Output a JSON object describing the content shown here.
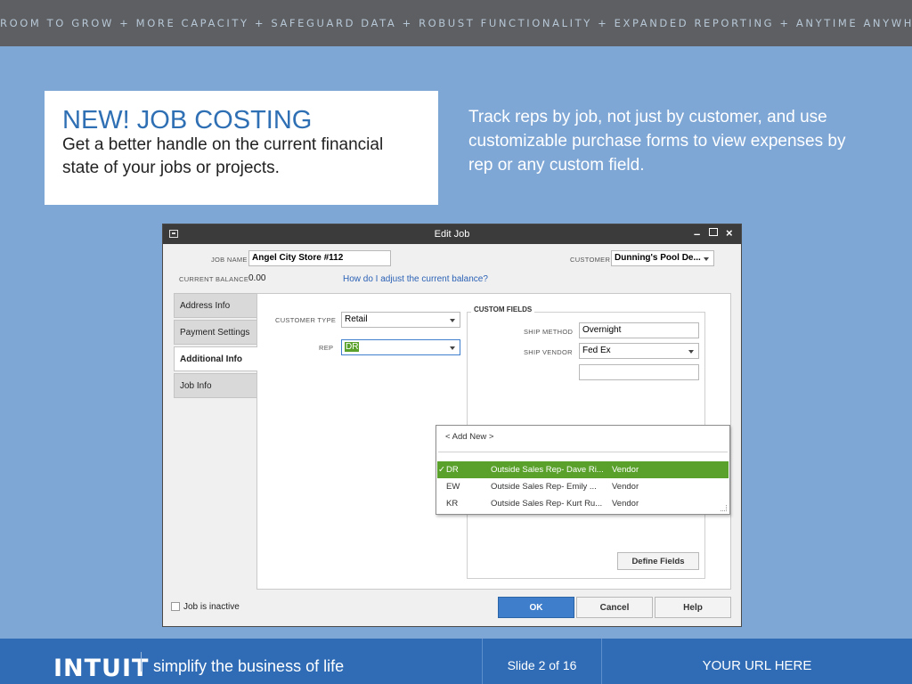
{
  "topbar": {
    "text": "ROOM TO GROW + MORE CAPACITY + SAFEGUARD DATA + ROBUST FUNCTIONALITY + EXPANDED REPORTING + ANYTIME ANYWHERE"
  },
  "headline": {
    "new": "NEW!",
    "title": "JOB COSTING",
    "subtitle": "Get a better handle on the current financial state of your jobs or projects."
  },
  "side_text": "Track reps by job, not just by customer, and use customizable purchase forms to view expenses by rep or any custom field.",
  "dialog": {
    "title": "Edit Job",
    "job_name_label": "JOB NAME",
    "job_name_value": "Angel City Store #112",
    "customer_label": "CUSTOMER",
    "customer_value": "Dunning's Pool De...",
    "balance_label": "CURRENT BALANCE",
    "balance_value": "0.00",
    "balance_link": "How do I adjust the current balance?",
    "tabs": [
      {
        "label": "Address Info"
      },
      {
        "label": "Payment Settings"
      },
      {
        "label": "Additional Info"
      },
      {
        "label": "Job Info"
      }
    ],
    "customer_type_label": "CUSTOMER TYPE",
    "customer_type_value": "Retail",
    "rep_label": "REP",
    "rep_value": "DR",
    "custom_fields": {
      "title": "CUSTOM FIELDS",
      "ship_method_label": "SHIP METHOD",
      "ship_method_value": "Overnight",
      "ship_vendor_label": "SHIP VENDOR",
      "ship_vendor_value": "Fed Ex",
      "define_fields": "Define Fields"
    },
    "rep_dropdown": {
      "add_new": "< Add New >",
      "items": [
        {
          "check": "✓",
          "code": "DR",
          "name": "Outside Sales Rep- Dave Ri...",
          "type": "Vendor"
        },
        {
          "check": "",
          "code": "EW",
          "name": "Outside Sales Rep- Emily ...",
          "type": "Vendor"
        },
        {
          "check": "",
          "code": "KR",
          "name": "Outside Sales Rep- Kurt Ru...",
          "type": "Vendor"
        }
      ]
    },
    "inactive_label": "Job is inactive",
    "ok": "OK",
    "cancel": "Cancel",
    "help": "Help"
  },
  "footer": {
    "logo": "INTUIT",
    "tagline": "simplify the business of life",
    "slide": "Slide 2 of 16",
    "url": "YOUR URL HERE"
  },
  "colors": {
    "background": "#7fa7d6",
    "headline_blue": "#2f6fb4",
    "footer_blue": "#2f6cb5",
    "selection_green": "#5aa12c",
    "ok_button": "#3e7ecb"
  }
}
